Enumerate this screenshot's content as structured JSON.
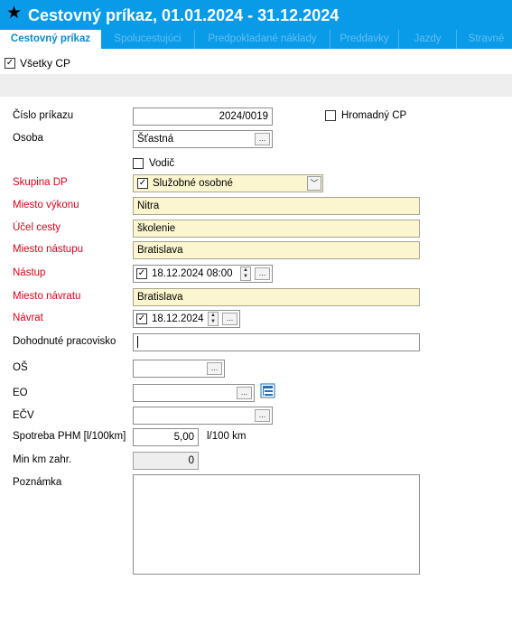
{
  "window": {
    "title": "Cestovný príkaz, 01.01.2024 - 31.12.2024",
    "star_icon": "star-icon"
  },
  "tabs": [
    {
      "label": "Cestovný príkaz",
      "active": true
    },
    {
      "label": "Spolucestujúci",
      "active": false
    },
    {
      "label": "Predpokladané náklady",
      "active": false
    },
    {
      "label": "Preddavky",
      "active": false
    },
    {
      "label": "Jazdy",
      "active": false
    },
    {
      "label": "Stravné",
      "active": false
    }
  ],
  "all_cp": {
    "label": "Všetky CP",
    "checked": true
  },
  "form": {
    "cislo_prikazu": {
      "label": "Číslo príkazu",
      "value": "2024/0019"
    },
    "hromadny_cp": {
      "label": "Hromadný CP",
      "checked": false
    },
    "osoba": {
      "label": "Osoba",
      "value": "Šťastná",
      "button": "..."
    },
    "vodic": {
      "label": "Vodič",
      "checked": false
    },
    "skupina_dp": {
      "label": "Skupina DP",
      "value": "Služobné osobné",
      "checked": true
    },
    "miesto_vykonu": {
      "label": "Miesto výkonu",
      "value": "Nitra"
    },
    "ucel_cesty": {
      "label": "Účel cesty",
      "value": "školenie"
    },
    "miesto_nastupu": {
      "label": "Miesto nástupu",
      "value": "Bratislava"
    },
    "nastup": {
      "label": "Nástup",
      "value": "18.12.2024 08:00",
      "checked": true,
      "button": "..."
    },
    "miesto_navratu": {
      "label": "Miesto návratu",
      "value": "Bratislava"
    },
    "navrat": {
      "label": "Návrat",
      "value": "18.12.2024",
      "checked": true,
      "button": "..."
    },
    "dohodnute_pracovisko": {
      "label": "Dohodnuté pracovisko",
      "value": ""
    },
    "os": {
      "label": "OŠ",
      "value": "",
      "button": "..."
    },
    "eo": {
      "label": "EO",
      "value": "",
      "button": "..."
    },
    "ecv": {
      "label": "EČV",
      "value": "",
      "button": "..."
    },
    "spotreba_phm": {
      "label": "Spotreba PHM [l/100km]",
      "value": "5,00",
      "unit": "l/100 km"
    },
    "min_km_zahr": {
      "label": "Min km zahr.",
      "value": "0"
    },
    "poznamka": {
      "label": "Poznámka",
      "value": ""
    }
  },
  "colors": {
    "accent": "#0a9be8",
    "required_label": "#e0001b",
    "required_field_bg": "#fbf6cf"
  }
}
